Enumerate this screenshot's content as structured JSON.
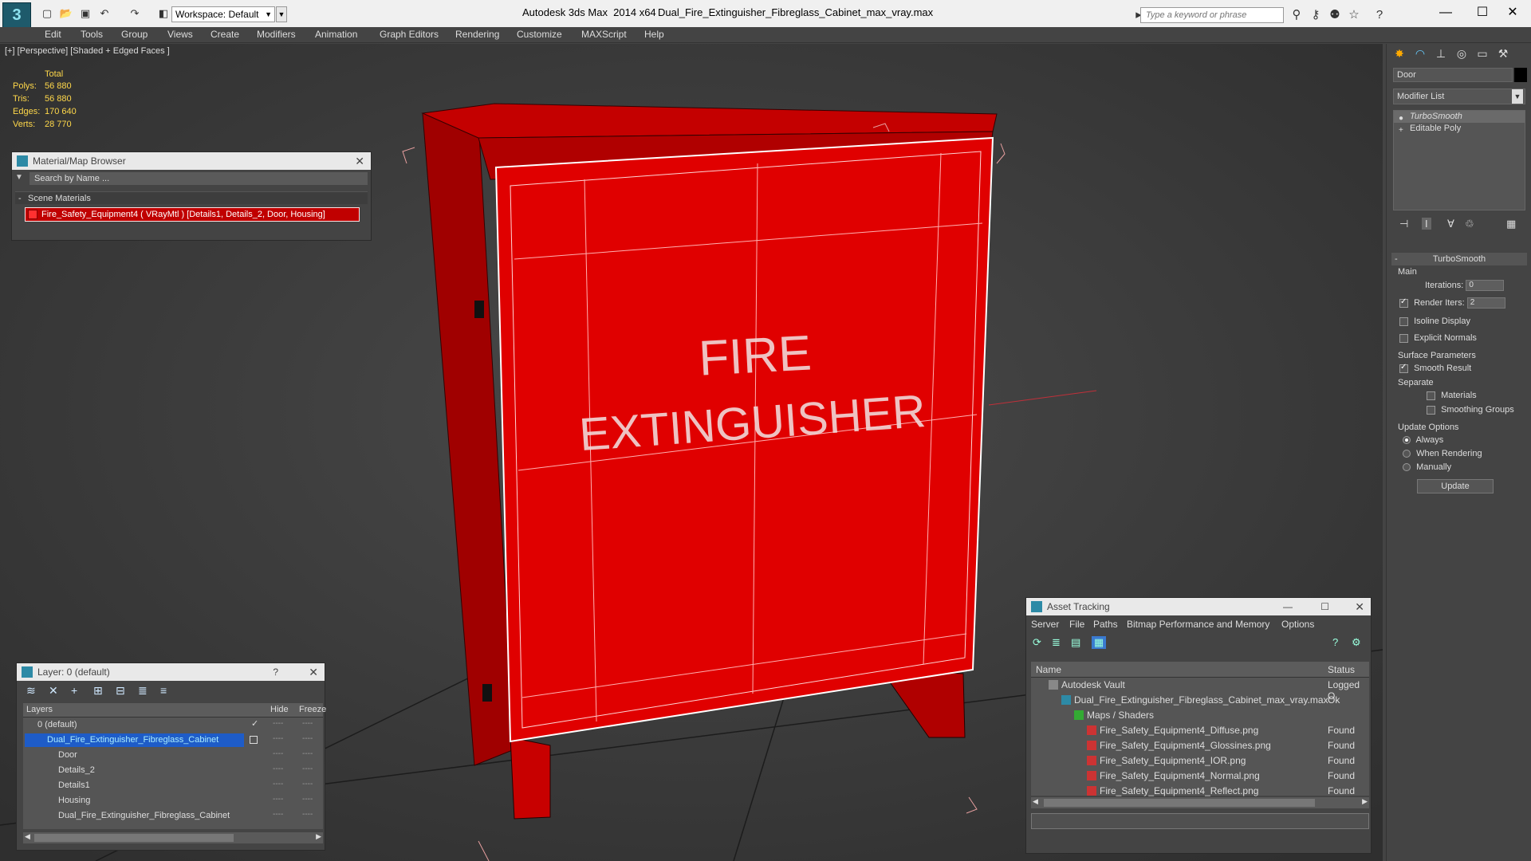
{
  "titlebar": {
    "workspace": "Workspace: Default",
    "app_title": "Autodesk 3ds Max  2014 x64",
    "file_title": "Dual_Fire_Extinguisher_Fibreglass_Cabinet_max_vray.max",
    "search_placeholder": "Type a keyword or phrase"
  },
  "menu": [
    "Edit",
    "Tools",
    "Group",
    "Views",
    "Create",
    "Modifiers",
    "Animation",
    "Graph Editors",
    "Rendering",
    "Customize",
    "MAXScript",
    "Help"
  ],
  "viewport": {
    "label": "[+] [Perspective] [Shaded + Edged Faces ]",
    "stats": {
      "header": "Total",
      "rows": [
        {
          "label": "Polys:",
          "value": "56 880"
        },
        {
          "label": "Tris:",
          "value": "56 880"
        },
        {
          "label": "Edges:",
          "value": "170 640"
        },
        {
          "label": "Verts:",
          "value": "28 770"
        }
      ]
    },
    "model_text": {
      "line1": "FIRE",
      "line2": "EXTINGUISHER"
    }
  },
  "material_browser": {
    "title": "Material/Map Browser",
    "search": "Search by Name ...",
    "category": "Scene Materials",
    "item": "Fire_Safety_Equipment4  ( VRayMtl )  [Details1, Details_2, Door, Housing]"
  },
  "layers": {
    "title": "Layer: 0 (default)",
    "help": "?",
    "columns": {
      "name": "Layers",
      "hide": "Hide",
      "freeze": "Freeze"
    },
    "rows": [
      {
        "name": "0 (default)"
      },
      {
        "name": "Dual_Fire_Extinguisher_Fibreglass_Cabinet"
      },
      {
        "name": "Door"
      },
      {
        "name": "Details_2"
      },
      {
        "name": "Details1"
      },
      {
        "name": "Housing"
      },
      {
        "name": "Dual_Fire_Extinguisher_Fibreglass_Cabinet"
      }
    ],
    "dash": "----"
  },
  "asset_tracking": {
    "title": "Asset Tracking",
    "menu": [
      "Server",
      "File",
      "Paths",
      "Bitmap Performance and Memory",
      "Options"
    ],
    "columns": {
      "name": "Name",
      "status": "Status"
    },
    "rows": [
      {
        "name": "Autodesk Vault",
        "status": "Logged O"
      },
      {
        "name": "Dual_Fire_Extinguisher_Fibreglass_Cabinet_max_vray.max",
        "status": "Ok"
      },
      {
        "name": "Maps / Shaders",
        "status": ""
      },
      {
        "name": "Fire_Safety_Equipment4_Diffuse.png",
        "status": "Found"
      },
      {
        "name": "Fire_Safety_Equipment4_Glossines.png",
        "status": "Found"
      },
      {
        "name": "Fire_Safety_Equipment4_IOR.png",
        "status": "Found"
      },
      {
        "name": "Fire_Safety_Equipment4_Normal.png",
        "status": "Found"
      },
      {
        "name": "Fire_Safety_Equipment4_Reflect.png",
        "status": "Found"
      }
    ]
  },
  "command_panel": {
    "object_name": "Door",
    "modifier_list": "Modifier List",
    "stack": [
      "TurboSmooth",
      "Editable Poly"
    ],
    "rollout_title": "TurboSmooth",
    "main_group": "Main",
    "iterations_label": "Iterations:",
    "iterations_value": "0",
    "render_iters_label": "Render Iters:",
    "render_iters_value": "2",
    "isoline": "Isoline Display",
    "explicit": "Explicit Normals",
    "surface_group": "Surface Parameters",
    "smooth_result": "Smooth Result",
    "separate": "Separate",
    "materials": "Materials",
    "smoothing_groups": "Smoothing Groups",
    "update_group": "Update Options",
    "always": "Always",
    "when_rendering": "When Rendering",
    "manually": "Manually",
    "update_btn": "Update"
  },
  "colors": {
    "accent": "#1e5cc8",
    "model_red": "#e00000",
    "stat_yellow": "#ffd84a"
  }
}
